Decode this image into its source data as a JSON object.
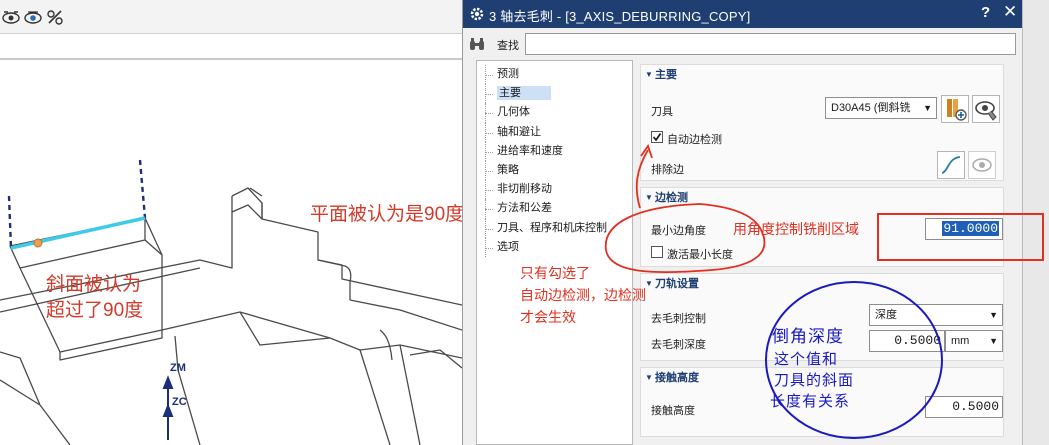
{
  "viewport": {
    "toolbar_icons": [
      "eye-split-icon",
      "eye-icon",
      "display-filter-icon"
    ],
    "callout_plane": "平面被认为是90度",
    "callout_slope": [
      "斜面被认为",
      "超过了90度"
    ],
    "axis_zm": "ZM",
    "axis_zc": "ZC",
    "colors": {
      "edge_highlight": "#3ecbe8",
      "callout": "#d23a2a",
      "axis": "#1c2e78"
    }
  },
  "dialog": {
    "title": "3 轴去毛刺 - [3_AXIS_DEBURRING_COPY]",
    "help": "?",
    "close": "✕",
    "find_label": "查找",
    "find_value": "",
    "nav_items": [
      "预测",
      "主要",
      "几何体",
      "轴和避让",
      "进给率和速度",
      "策略",
      "非切削移动",
      "方法和公差",
      "刀具、程序和机床控制",
      "选项"
    ],
    "nav_selected": "主要",
    "main": {
      "title": "主要",
      "tool_label": "刀具",
      "tool_value": "D30A45 (倒斜铣",
      "auto_edge_label": "自动边检测",
      "auto_edge_checked": true,
      "exclude_label": "排除边"
    },
    "edge_detect": {
      "title": "边检测",
      "min_angle_label": "最小边角度",
      "min_angle_value": "91.0000",
      "min_length_label": "激活最小长度",
      "min_length_checked": false
    },
    "toolpath": {
      "title": "刀轨设置",
      "deburr_ctrl_label": "去毛刺控制",
      "deburr_ctrl_value": "深度",
      "deburr_depth_label": "去毛刺深度",
      "deburr_depth_value": "0.5000",
      "deburr_depth_unit": "mm"
    },
    "contact": {
      "title": "接触高度",
      "contact_label": "接触高度",
      "contact_value": "0.5000"
    }
  },
  "annotations": {
    "angle_note": "用角度控制铣削区域",
    "check_note": [
      "只有勾选了",
      "自动边检测，边检测",
      "才会生效"
    ],
    "depth_note": [
      "倒角深度",
      "这个值和",
      "刀具的斜面",
      "长度有关系"
    ],
    "colors": {
      "red": "#e03020",
      "blue": "#1a1abf"
    }
  }
}
